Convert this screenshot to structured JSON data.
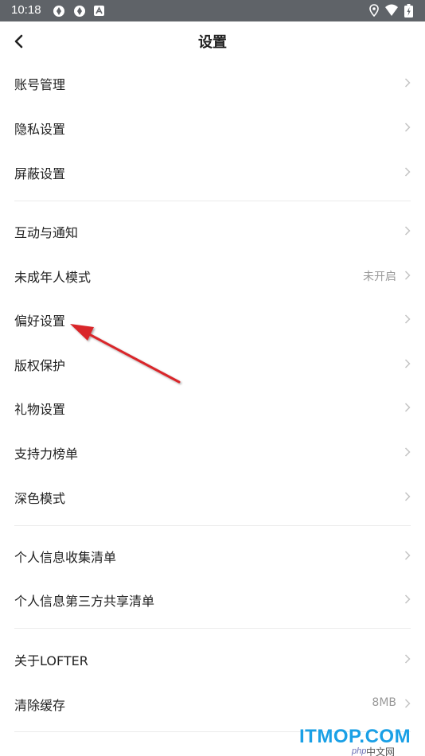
{
  "status_bar": {
    "time": "10:18",
    "left_icons": [
      "sync-icon",
      "sync-icon",
      "notification-a-icon"
    ],
    "right_icons": [
      "location-icon",
      "wifi-icon",
      "battery-icon"
    ]
  },
  "header": {
    "back_icon": "chevron-left-icon",
    "title": "设置"
  },
  "groups": [
    {
      "items": [
        {
          "label": "账号管理",
          "value": ""
        },
        {
          "label": "隐私设置",
          "value": ""
        },
        {
          "label": "屏蔽设置",
          "value": ""
        }
      ]
    },
    {
      "items": [
        {
          "label": "互动与通知",
          "value": ""
        },
        {
          "label": "未成年人模式",
          "value": "未开启"
        },
        {
          "label": "偏好设置",
          "value": ""
        },
        {
          "label": "版权保护",
          "value": ""
        },
        {
          "label": "礼物设置",
          "value": ""
        },
        {
          "label": "支持力榜单",
          "value": ""
        },
        {
          "label": "深色模式",
          "value": ""
        }
      ]
    },
    {
      "items": [
        {
          "label": "个人信息收集清单",
          "value": ""
        },
        {
          "label": "个人信息第三方共享清单",
          "value": ""
        }
      ]
    },
    {
      "items": [
        {
          "label": "关于LOFTER",
          "value": ""
        },
        {
          "label": "清除缓存",
          "value": "8MB"
        }
      ]
    }
  ],
  "watermark": {
    "main": "ITMOP.COM",
    "php": "php",
    "cn": "中文网"
  },
  "colors": {
    "status_bar": "#5f6368",
    "text": "#222222",
    "secondary": "#999999",
    "chevron": "#c4c4c4",
    "divider": "#ececec",
    "annotation_arrow": "#d9252a"
  }
}
